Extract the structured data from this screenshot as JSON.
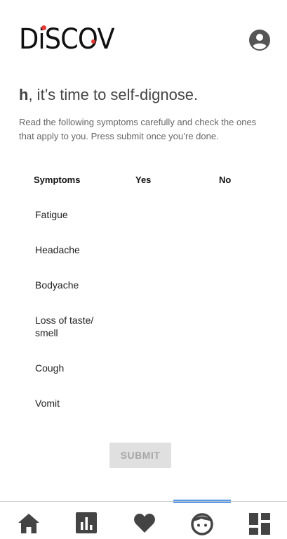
{
  "app": {
    "logo_text": "DiSCOV"
  },
  "header": {
    "profile_icon": "account-circle-icon"
  },
  "page": {
    "headline_prefix": "h",
    "headline_rest": ", it’s time to self-dignose.",
    "instructions": "Read the following symptoms carefully and check the ones that apply to you. Press submit once you’re done."
  },
  "table": {
    "headers": {
      "symptoms": "Symptoms",
      "yes": "Yes",
      "no": "No"
    },
    "rows": [
      {
        "symptom": "Fatigue"
      },
      {
        "symptom": "Headache"
      },
      {
        "symptom": "Bodyache"
      },
      {
        "symptom": "Loss of taste/ smell"
      },
      {
        "symptom": "Cough"
      },
      {
        "symptom": "Vomit"
      }
    ]
  },
  "actions": {
    "submit_label": "SUBMIT"
  },
  "bottom_nav": {
    "items": [
      {
        "icon": "home-icon"
      },
      {
        "icon": "stats-chart-icon"
      },
      {
        "icon": "heart-icon"
      },
      {
        "icon": "face-icon",
        "active": true
      },
      {
        "icon": "dashboard-icon"
      }
    ]
  },
  "colors": {
    "active_indicator": "#5b9ae8",
    "logo_accent": "#e53935"
  }
}
